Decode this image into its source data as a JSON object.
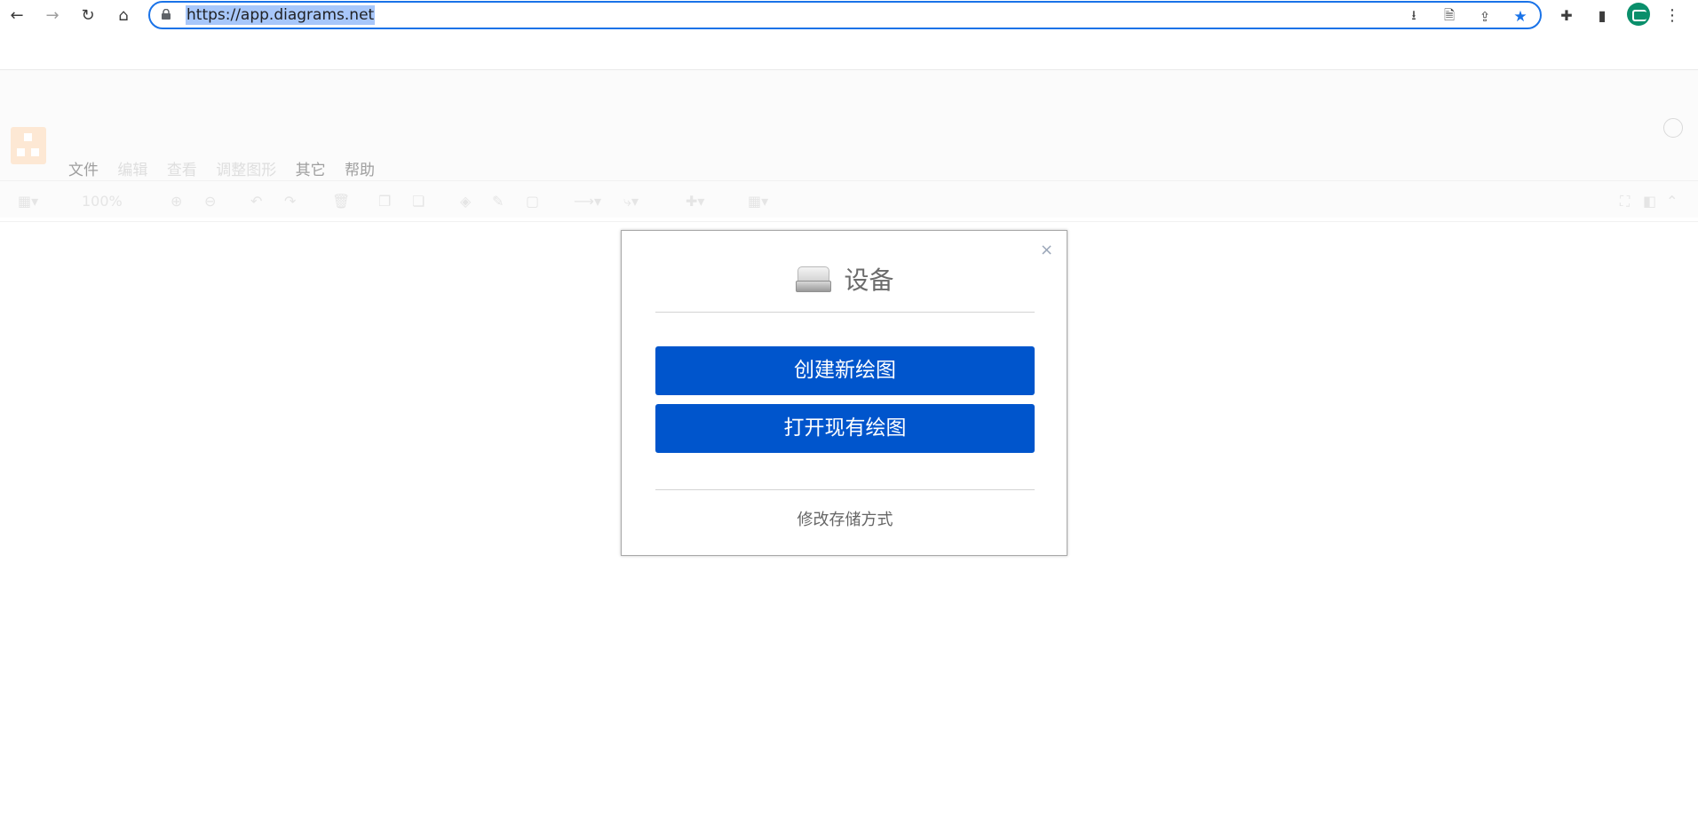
{
  "browser": {
    "url": "https://app.diagrams.net"
  },
  "menu": {
    "items": [
      "文件",
      "编辑",
      "查看",
      "调整图形",
      "其它",
      "帮助"
    ]
  },
  "toolbar": {
    "zoom": "100%"
  },
  "dialog": {
    "title": "设备",
    "close": "×",
    "create_button": "创建新绘图",
    "open_button": "打开现有绘图",
    "change_storage": "修改存储方式"
  },
  "colors": {
    "primary_button": "#0055cc",
    "omnibox_border": "#1a73e8"
  }
}
